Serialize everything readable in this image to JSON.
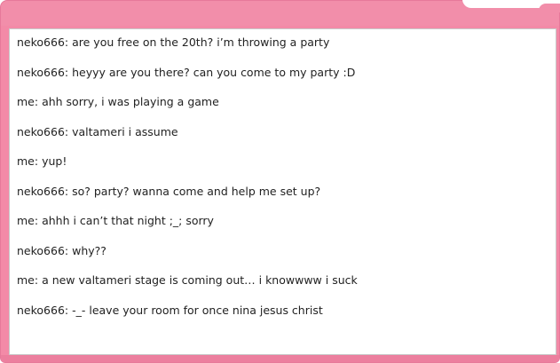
{
  "colors": {
    "window_pink": "#f38aa7",
    "panel_background": "#ffffff",
    "text": "#222222"
  },
  "chat": {
    "messages": [
      {
        "sender": "neko666",
        "text": "are you free on the 20th? i’m throwing a party"
      },
      {
        "sender": "neko666",
        "text": "heyyy are you there? can you come to my party :D"
      },
      {
        "sender": "me",
        "text": "ahh sorry, i was playing a game"
      },
      {
        "sender": "neko666",
        "text": "valtameri i assume"
      },
      {
        "sender": "me",
        "text": "yup!"
      },
      {
        "sender": "neko666",
        "text": "so? party? wanna come and help me set up?"
      },
      {
        "sender": "me",
        "text": "ahhh i can’t that night ;_; sorry"
      },
      {
        "sender": "neko666",
        "text": "why??"
      },
      {
        "sender": "me",
        "text": "a new valtameri stage is coming out… i knowwww i suck"
      },
      {
        "sender": "neko666",
        "text": "-_- leave your room for once nina jesus christ"
      }
    ]
  }
}
